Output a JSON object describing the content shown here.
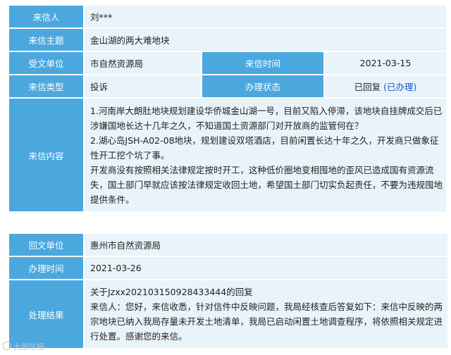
{
  "letter": {
    "sender": {
      "label": "来信人",
      "value": "刘***"
    },
    "subject": {
      "label": "来信主题",
      "value": "金山湖的两大难地块"
    },
    "dept": {
      "label": "受文单位",
      "value": "市自然资源局"
    },
    "time": {
      "label": "来信时间",
      "value": "2021-03-15"
    },
    "type": {
      "label": "来信类型",
      "value": "投诉"
    },
    "status": {
      "label": "办理状态",
      "value": "已回复",
      "link": "(已办理)"
    },
    "content": {
      "label": "来信内容",
      "paragraphs": [
        "1.河南岸大朗肚地块规划建设华侨城金山湖一号，目前又陷入停滞，该地块自挂牌成交后已涉嫌国地长达十几年之久，不知道国土资源部门对开放商的监管何在？",
        "2.湖心岛JSH-A02-08地块，规划建设双塔酒店，目前闲置长达十年之久，开发商只做象征性开工挖个坑了事。",
        "开发商没有按照相关法律规定按时开工，这种低价圈地变相囤地的歪风已造成国有资源流失，国土部门早就应该按法律规定收回土地，希望国土部门切实负起责任，不要为违规囤地提供条件。"
      ]
    }
  },
  "reply": {
    "unit": {
      "label": "回文单位",
      "value": "惠州市自然资源局"
    },
    "time": {
      "label": "办理时间",
      "value": "2021-03-26"
    },
    "result": {
      "label": "处理结果",
      "paragraphs": [
        "关于Jzxx20210315092843344​4的回复",
        "来信人：您好，来信收悉，针对信件中反映问题，我局经核查后答复如下：来信中反映的两宗地块已纳入我局存量未开发土地清单，我局已启动闲置土地调查程序，将依照相关规定进行处置。感谢您的来信。"
      ]
    }
  },
  "watermark": {
    "text": "大部信报"
  }
}
